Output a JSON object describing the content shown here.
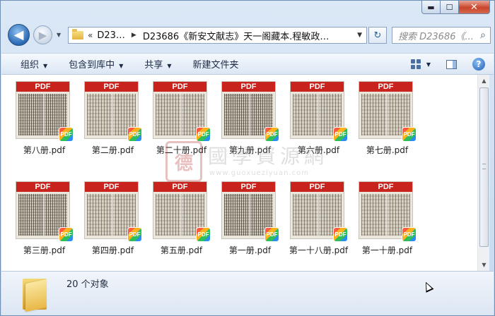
{
  "window": {
    "min_label": "▬",
    "max_label": "☐",
    "close_label": "✕"
  },
  "address": {
    "back_arrow": "◀",
    "forward_arrow": "▶",
    "history_arrow": "▼",
    "overflow": "«",
    "crumb_1": "D23…",
    "crumb_2": "D23686《新安文献志》天一阁藏本.程敏政…",
    "dropdown_arrow": "▼",
    "refresh_glyph": "↻"
  },
  "search": {
    "placeholder": "搜索 D23686《...",
    "icon_glyph": "⌕"
  },
  "toolbar": {
    "organize": "组织",
    "include_library": "包含到库中",
    "share": "共享",
    "new_folder": "新建文件夹",
    "help_glyph": "?"
  },
  "files": [
    {
      "name": "第八册.pdf"
    },
    {
      "name": "第二册.pdf"
    },
    {
      "name": "第二十册.pdf"
    },
    {
      "name": "第九册.pdf"
    },
    {
      "name": "第六册.pdf"
    },
    {
      "name": "第七册.pdf"
    },
    {
      "name": "第三册.pdf"
    },
    {
      "name": "第四册.pdf"
    },
    {
      "name": "第五册.pdf"
    },
    {
      "name": "第一册.pdf"
    },
    {
      "name": "第一十八册.pdf"
    },
    {
      "name": "第一十册.pdf"
    }
  ],
  "pdf_band_label": "PDF",
  "pdf_badge_label": "PDF",
  "watermark": {
    "seal": "德",
    "title": "國學資源網",
    "url": "www.guoxueziyuan.com"
  },
  "status": {
    "count": "20 个对象"
  },
  "colors": {
    "accent": "#2a69b4",
    "pdf_red": "#c9231d",
    "close_red": "#c8452b"
  }
}
